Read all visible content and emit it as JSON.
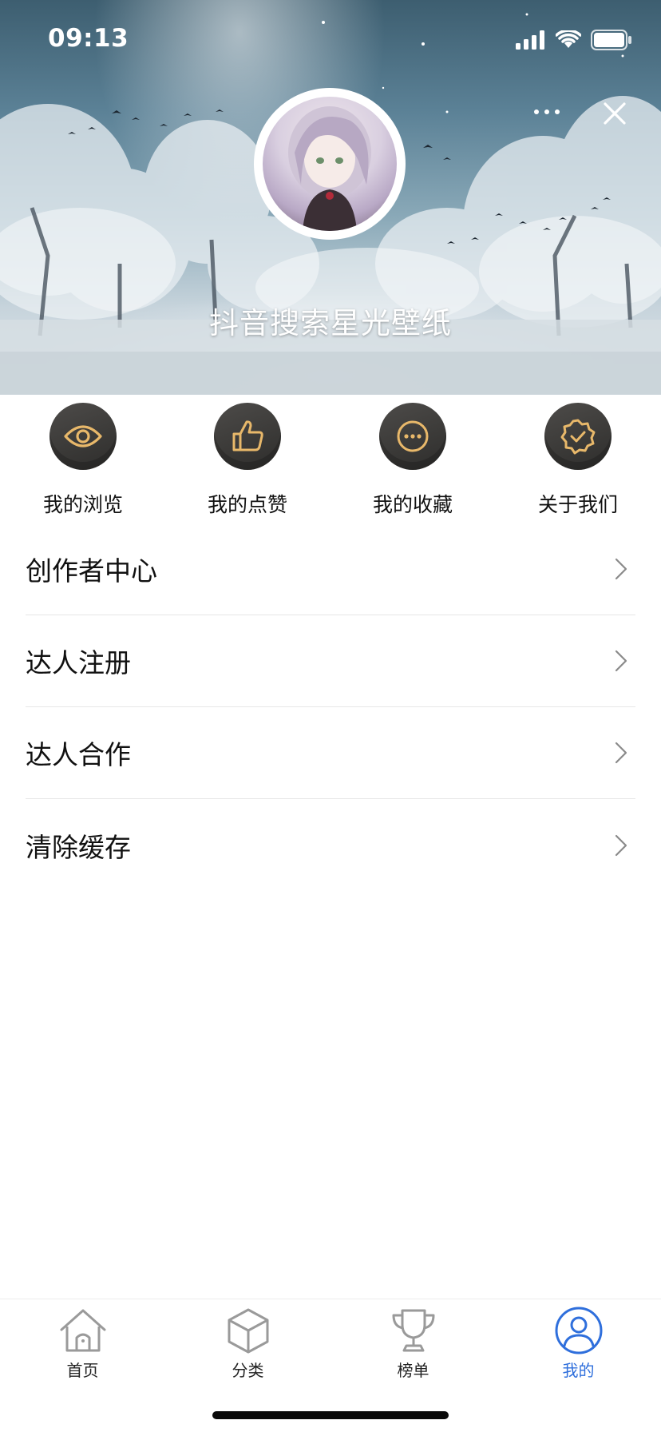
{
  "status_bar": {
    "time": "09:13"
  },
  "header": {
    "profile_name": "抖音搜索星光壁纸",
    "more_icon": "more-dots-icon",
    "close_icon": "close-icon"
  },
  "quick_actions": [
    {
      "label": "我的浏览",
      "icon": "eye-icon"
    },
    {
      "label": "我的点赞",
      "icon": "thumbs-up-icon"
    },
    {
      "label": "我的收藏",
      "icon": "chat-dots-icon"
    },
    {
      "label": "关于我们",
      "icon": "badge-check-icon"
    }
  ],
  "menu": [
    {
      "label": "创作者中心"
    },
    {
      "label": "达人注册"
    },
    {
      "label": "达人合作"
    },
    {
      "label": "清除缓存"
    }
  ],
  "tabbar": [
    {
      "label": "首页",
      "icon": "home-icon",
      "active": false
    },
    {
      "label": "分类",
      "icon": "cube-icon",
      "active": false
    },
    {
      "label": "榜单",
      "icon": "trophy-icon",
      "active": false
    },
    {
      "label": "我的",
      "icon": "user-icon",
      "active": true
    }
  ],
  "colors": {
    "accent": "#2f6fdc",
    "icon_gold": "#e8b86a",
    "icon_bg": "#3c3b39"
  }
}
